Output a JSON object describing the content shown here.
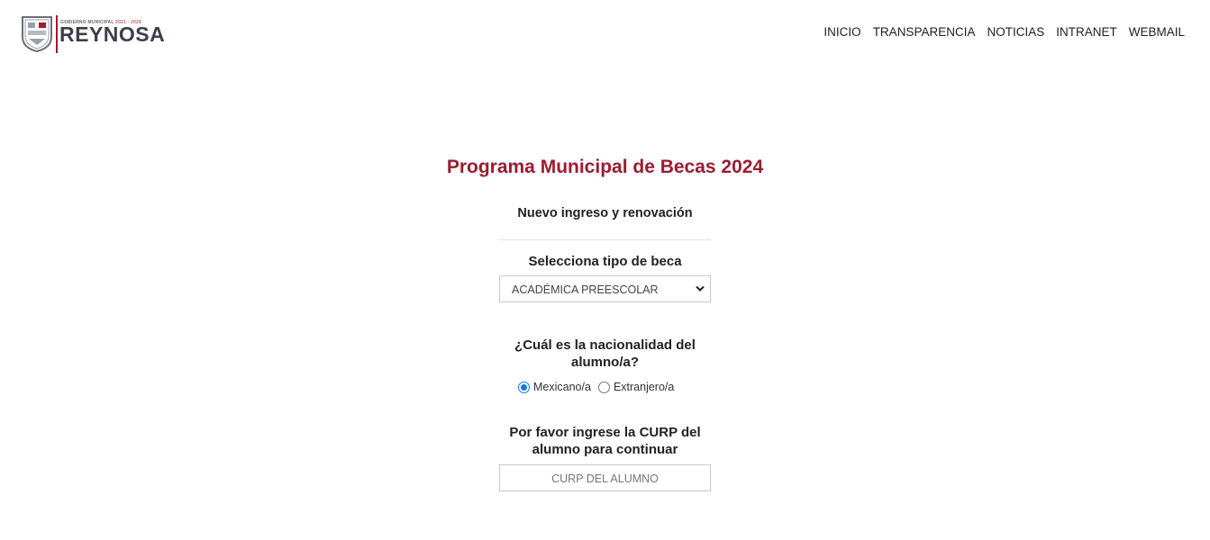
{
  "header": {
    "logo_small": "GOBIERNO MUNICIPAL",
    "logo_years": "2021 - 2024",
    "logo_big": "REYNOSA",
    "nav": [
      "INICIO",
      "TRANSPARENCIA",
      "NOTICIAS",
      "INTRANET",
      "WEBMAIL"
    ]
  },
  "main": {
    "title": "Programa Municipal de Becas 2024",
    "subtitle": "Nuevo ingreso y renovación",
    "beca": {
      "label": "Selecciona tipo de beca",
      "selected": "ACADÉMICA PREESCOLAR"
    },
    "nacionalidad": {
      "label_line1": "¿Cuál es la nacionalidad del",
      "label_line2": "alumno/a?",
      "options": [
        {
          "label": "Mexicano/a",
          "checked": true
        },
        {
          "label": "Extranjero/a",
          "checked": false
        }
      ]
    },
    "curp": {
      "label_line1": "Por favor ingrese la CURP del",
      "label_line2": "alumno para continuar",
      "placeholder": "CURP DEL ALUMNO"
    }
  },
  "colors": {
    "brand": "#9b1c31",
    "logo_text": "#3c3f4a",
    "radio_accent": "#1a73e8"
  },
  "icons": [
    "municipal-shield-icon",
    "chevron-down-icon"
  ]
}
